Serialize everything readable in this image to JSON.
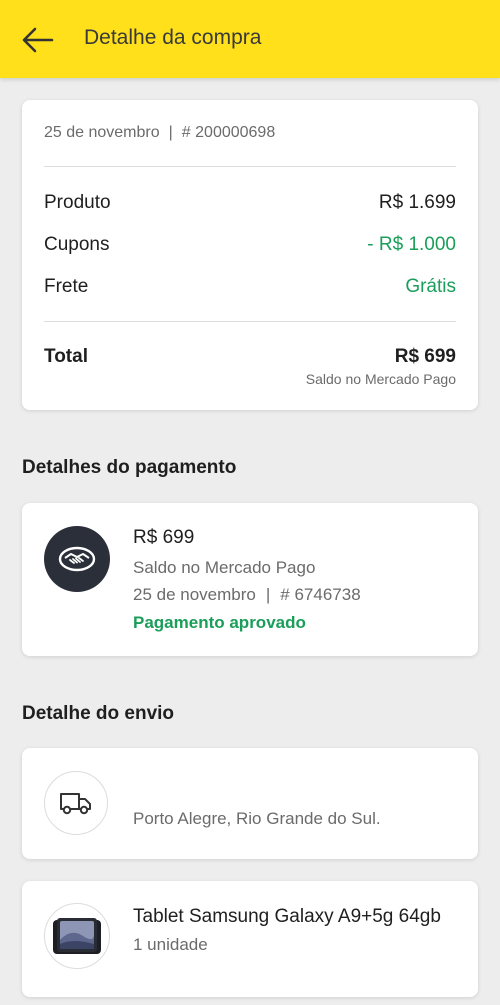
{
  "header": {
    "title": "Detalhe da compra",
    "back_icon": "arrow-left-icon",
    "background_color": "#ffe01b"
  },
  "summary": {
    "date": "25 de novembro",
    "separator": "|",
    "order_number": "# 200000698",
    "rows": [
      {
        "label": "Produto",
        "value": "R$ 1.699"
      },
      {
        "label": "Cupons",
        "value": "- R$ 1.000"
      },
      {
        "label": "Frete",
        "value": "Grátis"
      }
    ],
    "total_label": "Total",
    "total_value": "R$ 699",
    "total_sub": "Saldo no Mercado Pago"
  },
  "payment": {
    "section_title": "Detalhes do pagamento",
    "icon": "mercado-pago-handshake-icon",
    "amount": "R$ 699",
    "method": "Saldo no Mercado Pago",
    "date": "25 de novembro",
    "separator": "|",
    "transaction_number": "# 6746738",
    "status": "Pagamento aprovado",
    "status_color": "#1a9e5a"
  },
  "shipping": {
    "section_title": "Detalhe do envio",
    "icon": "truck-icon",
    "address": "Porto Alegre, Rio Grande do Sul."
  },
  "product": {
    "name": "Tablet Samsung Galaxy A9+5g 64gb",
    "quantity": "1 unidade",
    "icon": "tablet-thumbnail"
  }
}
